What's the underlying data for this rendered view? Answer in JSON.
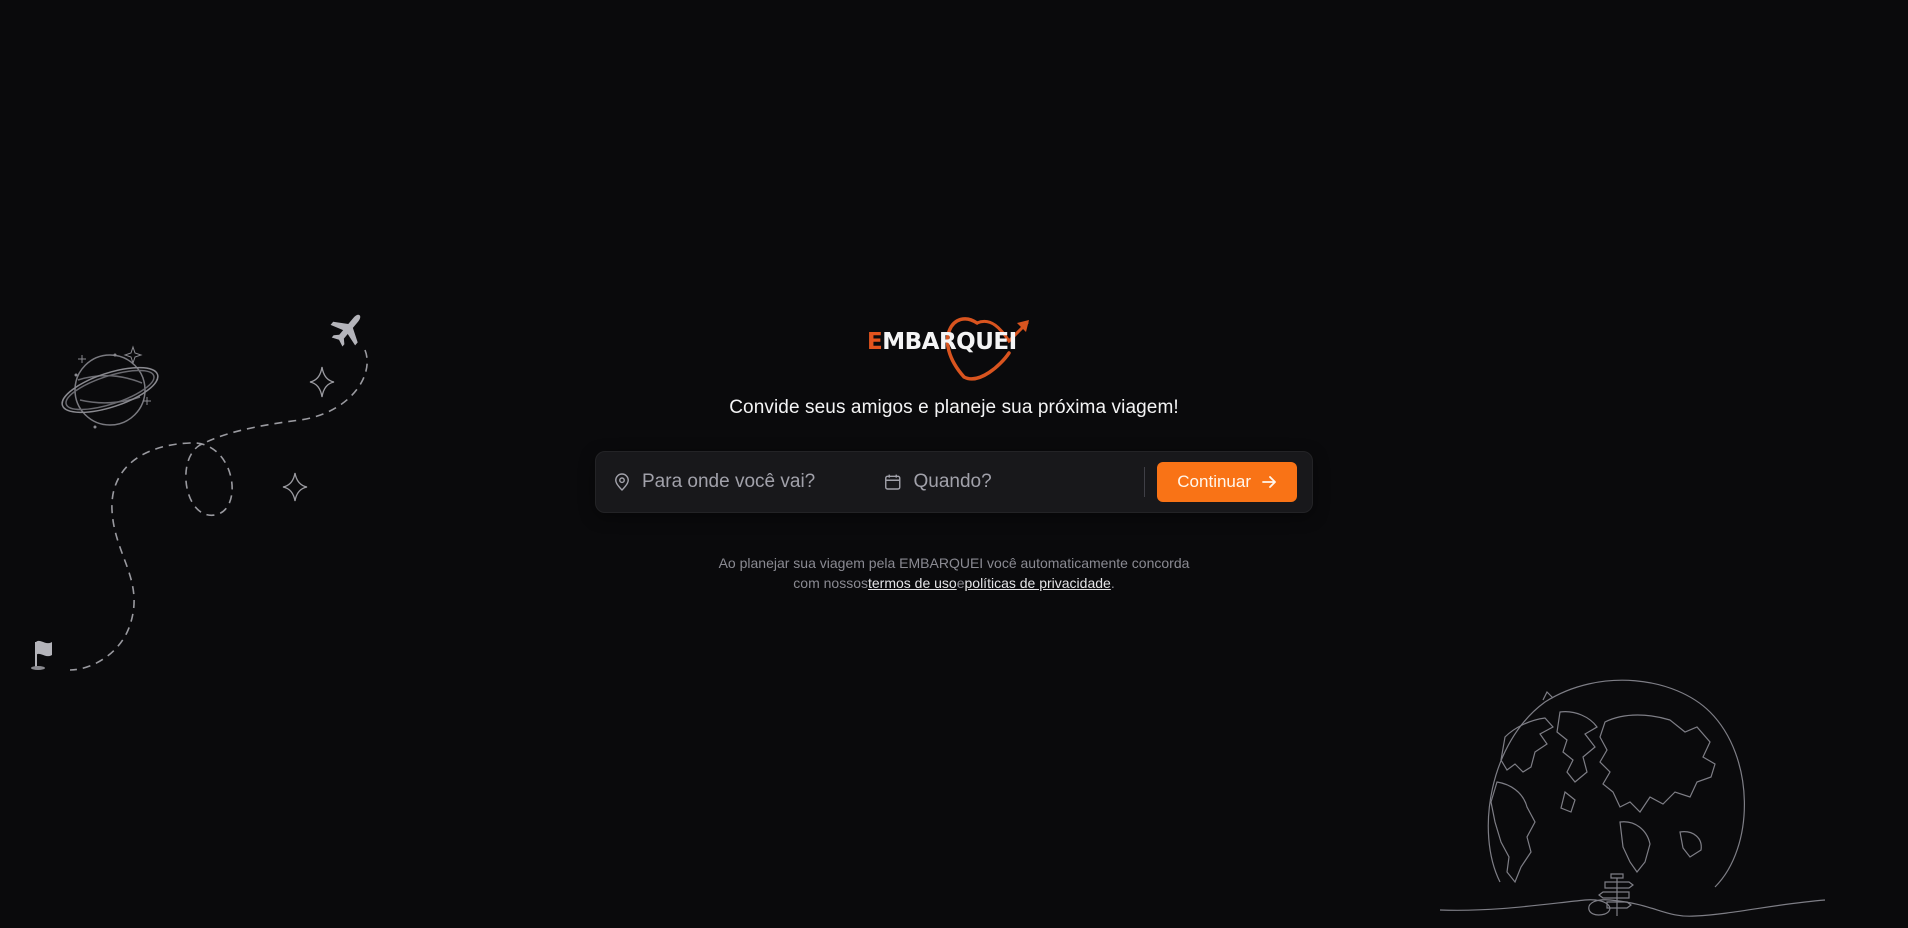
{
  "brand": {
    "logo_first_letter": "E",
    "logo_rest": "MBARQUEI",
    "accent_color": "#e4541d",
    "button_color": "#f97316"
  },
  "tagline": "Convide seus amigos e planeje sua próxima viagem!",
  "search": {
    "destination_placeholder": "Para onde você vai?",
    "destination_value": "",
    "date_placeholder": "Quando?",
    "date_value": "",
    "destination_icon": "map-pin-icon",
    "date_icon": "calendar-icon",
    "continue_label": "Continuar",
    "continue_icon": "arrow-right-icon"
  },
  "terms": {
    "line1": "Ao planejar sua viagem pela EMBARQUEI você automaticamente concorda",
    "prefix": "com nossos",
    "terms_link": "termos de uso",
    "conjunction": "e",
    "privacy_link": "políticas de privacidade",
    "suffix": "."
  },
  "decorations": {
    "left_icons": [
      "planet-icon",
      "airplane-icon",
      "sparkle-icon",
      "flag-icon"
    ],
    "right_icons": [
      "globe-icon",
      "signpost-icon"
    ]
  }
}
